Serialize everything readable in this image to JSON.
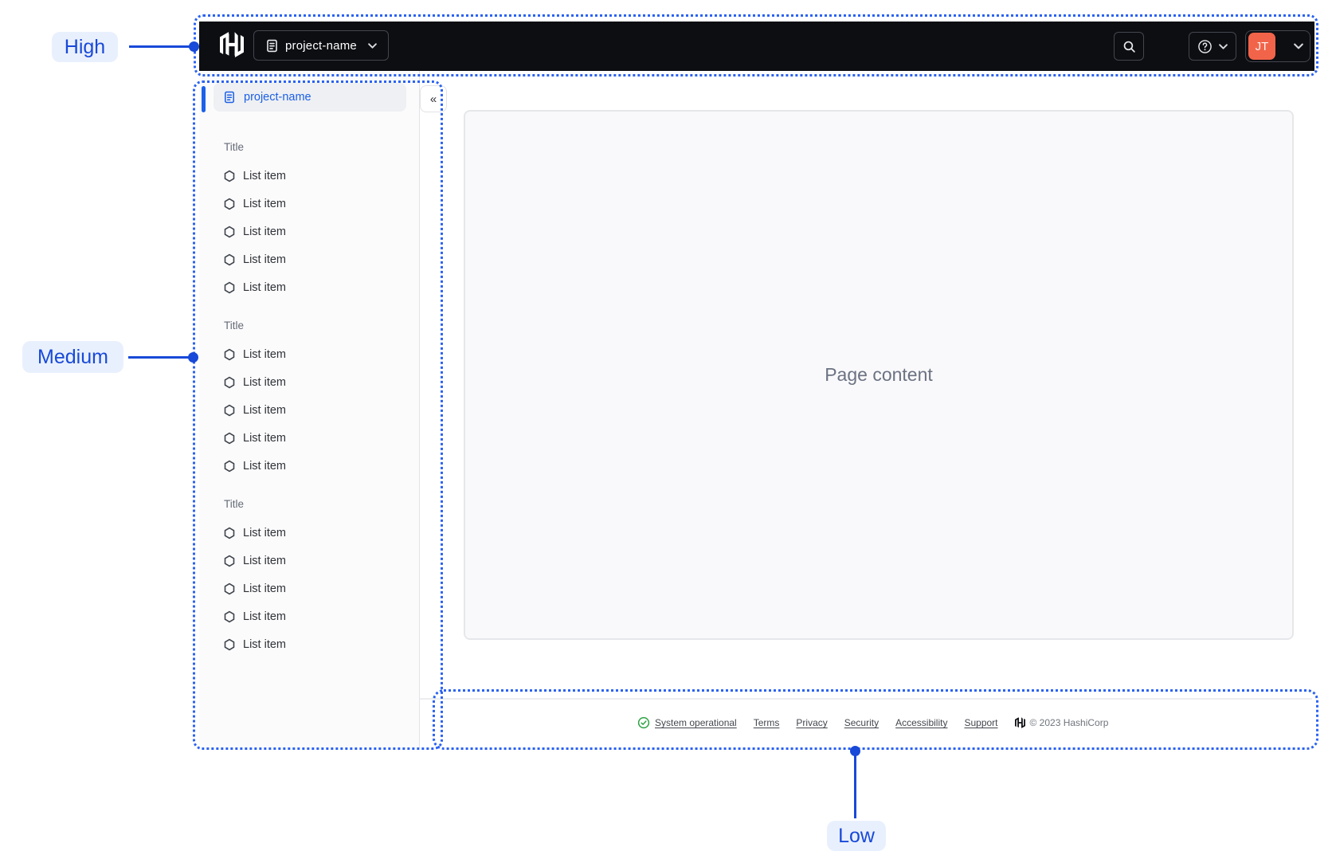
{
  "annotations": {
    "high": {
      "label": "High"
    },
    "medium": {
      "label": "Medium"
    },
    "low": {
      "label": "Low"
    }
  },
  "header": {
    "logo": "hashicorp-logo-mark",
    "project_switcher": {
      "label": "project-name",
      "icon": "file-text-icon",
      "chevron": "chevron-down-icon"
    },
    "search": {
      "icon": "search-icon"
    },
    "help": {
      "icon": "help-question-circle-icon",
      "chevron": "chevron-down-icon"
    },
    "account": {
      "avatar_initials": "JT",
      "chevron": "chevron-down-icon"
    }
  },
  "sidebar": {
    "active_item": {
      "label": "project-name",
      "icon": "file-text-icon"
    },
    "collapse_glyph": "«",
    "sections": [
      {
        "title": "Title",
        "items": [
          "List item",
          "List item",
          "List item",
          "List item",
          "List item"
        ]
      },
      {
        "title": "Title",
        "items": [
          "List item",
          "List item",
          "List item",
          "List item",
          "List item"
        ]
      },
      {
        "title": "Title",
        "items": [
          "List item",
          "List item",
          "List item",
          "List item",
          "List item"
        ]
      }
    ],
    "item_icon": "hexagon-outline-icon"
  },
  "main": {
    "placeholder": "Page content"
  },
  "footer": {
    "status": {
      "label": "System operational",
      "icon": "check-circle-icon"
    },
    "links": [
      "Terms",
      "Privacy",
      "Security",
      "Accessibility",
      "Support"
    ],
    "copyright": "© 2023 HashiCorp"
  },
  "colors": {
    "annotation_blue": "#1849D8",
    "annotation_dots": "#2B62F2",
    "annotation_pill_bg": "#E9F0FD",
    "header_bg": "#0D0E12",
    "avatar_orange": "#F1644A",
    "active_link_blue": "#1C5FE5",
    "accent_bar_blue": "#1C61E9",
    "success_green": "#2EA244",
    "sidebar_bg": "#FBFBFC",
    "panel_bg": "#F9F9FB"
  }
}
